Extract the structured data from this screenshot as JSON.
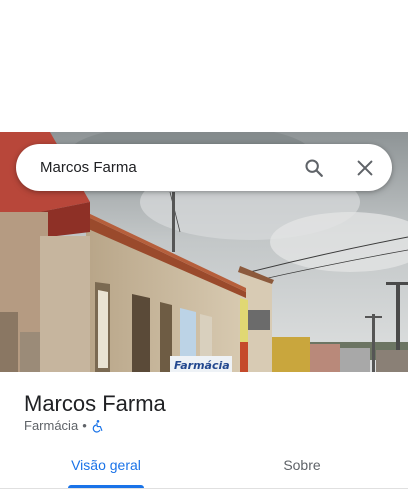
{
  "search": {
    "query": "Marcos Farma",
    "search_icon": "search-icon",
    "close_icon": "close-icon"
  },
  "photo": {
    "sign_text": "Farmácia"
  },
  "place": {
    "name": "Marcos Farma",
    "category": "Farmácia",
    "separator": "•",
    "accessibility_icon": "wheelchair-icon"
  },
  "tabs": [
    {
      "label": "Visão geral",
      "active": true
    },
    {
      "label": "Sobre",
      "active": false
    }
  ],
  "colors": {
    "accent": "#1a73e8",
    "text_primary": "#202124",
    "text_secondary": "#5f6368"
  }
}
